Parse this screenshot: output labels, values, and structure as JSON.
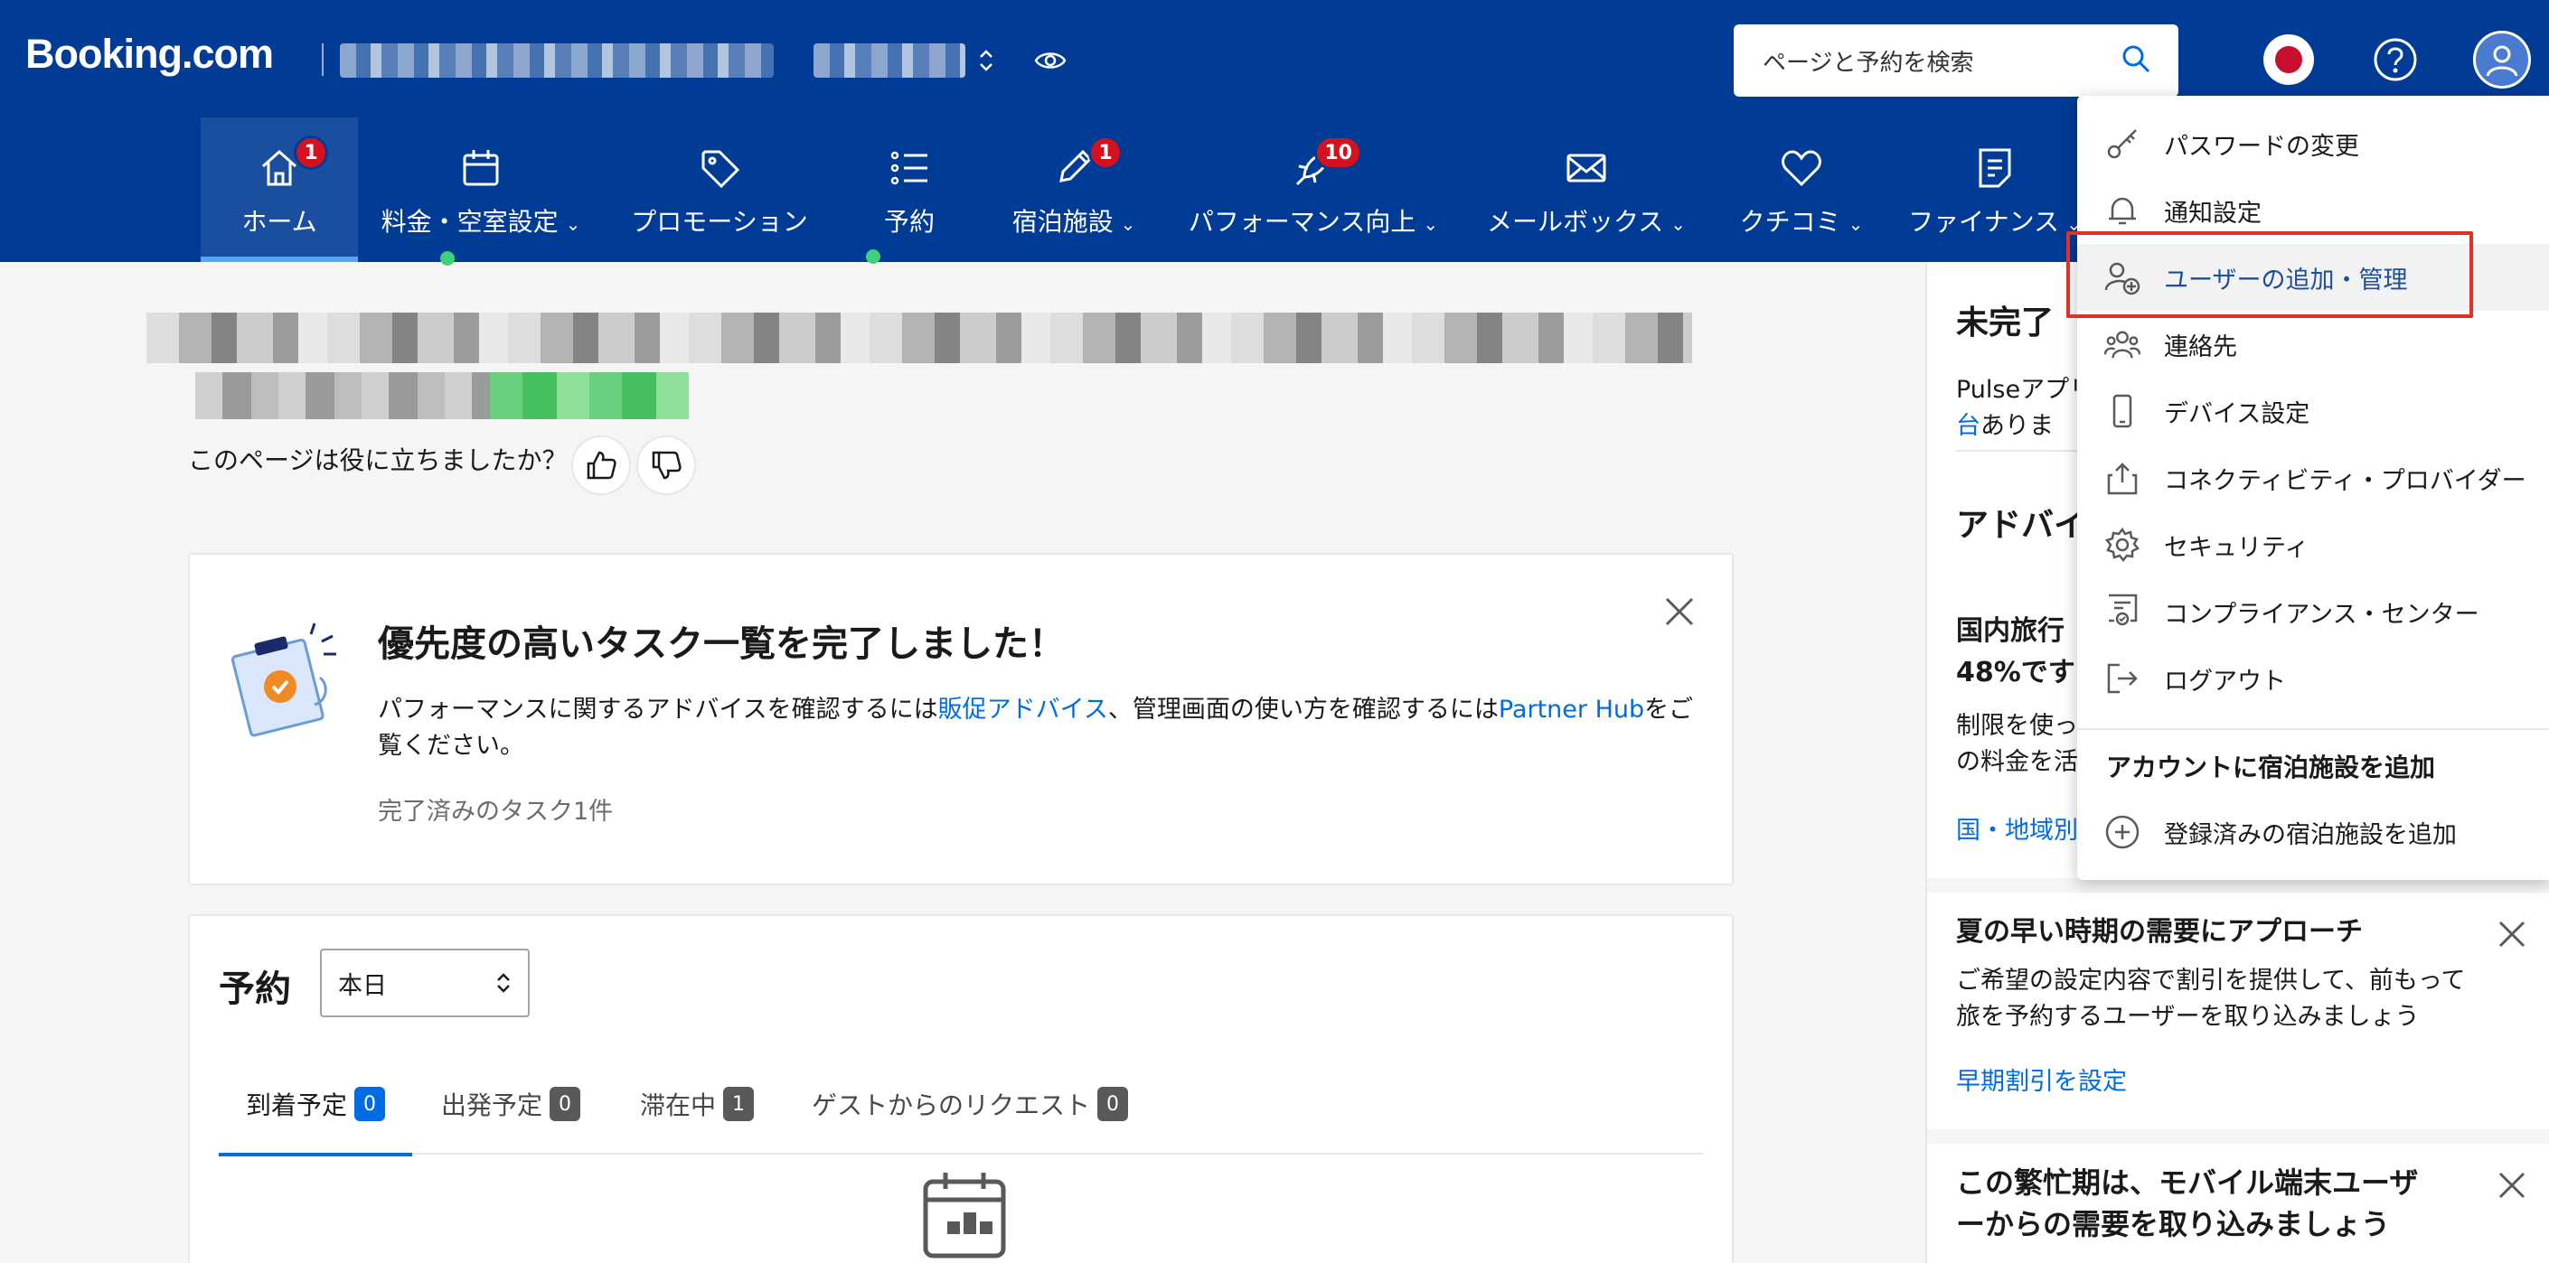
{
  "header": {
    "logo": "Booking.com",
    "search_placeholder": "ページと予約を検索"
  },
  "nav": {
    "items": [
      {
        "label": "ホーム",
        "badge": "1"
      },
      {
        "label": "料金・空室設定",
        "chevron": "⌄"
      },
      {
        "label": "プロモーション"
      },
      {
        "label": "予約"
      },
      {
        "label": "宿泊施設",
        "badge": "1",
        "chevron": "⌄"
      },
      {
        "label": "パフォーマンス向上",
        "badge": "10",
        "chevron": "⌄"
      },
      {
        "label": "メールボックス",
        "chevron": "⌄"
      },
      {
        "label": "クチコミ",
        "chevron": "⌄"
      },
      {
        "label": "ファイナンス",
        "chevron": "⌄"
      }
    ]
  },
  "feedback": {
    "question": "このページは役に立ちましたか？"
  },
  "task_card": {
    "title": "優先度の高いタスク一覧を完了しました！",
    "body_pre": "パフォーマンスに関するアドバイスを確認するには",
    "link1": "販促アドバイス",
    "body_mid": "、管理画面の使い方を確認するには",
    "link2": "Partner Hub",
    "body_post": "をご覧ください。",
    "done": "完了済みのタスク1件"
  },
  "reservations": {
    "title": "予約",
    "select_value": "本日",
    "tabs": [
      {
        "label": "到着予定",
        "count": "0"
      },
      {
        "label": "出発予定",
        "count": "0"
      },
      {
        "label": "滞在中",
        "count": "1"
      },
      {
        "label": "ゲストからのリクエスト",
        "count": "0"
      }
    ]
  },
  "sidebar": {
    "sec1_title": "未完了",
    "sec1_text1": "Pulseアプリ",
    "sec1_text2_link": "台",
    "sec1_text2": "ありま",
    "sec2_title": "アドバイ",
    "sec2_sub1": "国内旅行",
    "sec2_sub2": "48%です",
    "sec2_text1": "制限を使っ",
    "sec2_text2": "の料金を活",
    "sec2_link": "国・地域別",
    "sec3_title": "夏の早い時期の需要にアプローチ",
    "sec3_text1": "ご希望の設定内容で割引を提供して、前もって",
    "sec3_text2": "旅を予約するユーザーを取り込みましょう",
    "sec3_link": "早期割引を設定",
    "sec4_title1": "この繁忙期は、モバイル端末ユーザ",
    "sec4_title2": "ーからの需要を取り込みましょう"
  },
  "account_menu": {
    "items": [
      {
        "label": "パスワードの変更",
        "icon": "key-icon"
      },
      {
        "label": "通知設定",
        "icon": "bell-icon"
      },
      {
        "label": "ユーザーの追加・管理",
        "icon": "add-user-icon"
      },
      {
        "label": "連絡先",
        "icon": "contacts-icon"
      },
      {
        "label": "デバイス設定",
        "icon": "phone-icon"
      },
      {
        "label": "コネクティビティ・プロバイダー",
        "icon": "share-icon"
      },
      {
        "label": "セキュリティ",
        "icon": "gear-icon"
      },
      {
        "label": "コンプライアンス・センター",
        "icon": "certificate-icon"
      },
      {
        "label": "ログアウト",
        "icon": "logout-icon"
      }
    ],
    "section_title": "アカウントに宿泊施設を追加",
    "add_property": "登録済みの宿泊施設を追加"
  },
  "colors": {
    "brand": "#003b95",
    "link": "#006ce4",
    "badge": "#d4111e",
    "highlight_box": "#e0302a"
  }
}
